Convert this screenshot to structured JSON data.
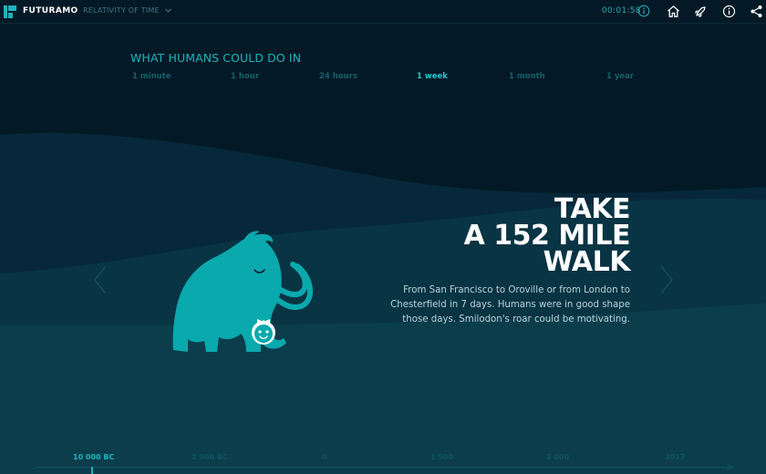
{
  "header": {
    "brand": "FUTURAMO",
    "section": "RELATIVITY OF TIME",
    "timer": "00:01:58",
    "icons": [
      "logo-icon",
      "chevron-down-icon",
      "info-icon",
      "home-icon",
      "rocket-icon",
      "info-icon",
      "share-icon"
    ]
  },
  "periods": {
    "title": "WHAT HUMANS COULD DO IN",
    "items": [
      "1 minute",
      "1 hour",
      "24 hours",
      "1 week",
      "1 month",
      "1 year"
    ],
    "active": "1 week"
  },
  "slide": {
    "headline_lines": [
      "TAKE",
      "A 152 MILE",
      "WALK"
    ],
    "description": "From San Francisco to Oroville or from London to Chesterfield in 7 days. Humans were in good shape those days. Smilodon's roar could be motivating.",
    "illustration": "mammoth-illustration"
  },
  "timeline": {
    "labels": [
      "10 000 BC",
      "2 000 BC",
      "0",
      "1 500",
      "2 000",
      "2017"
    ],
    "active": "10 000 BC"
  },
  "colors": {
    "background": "#031a26",
    "accent": "#1fb3bd",
    "mammoth": "#0aa9ad",
    "hill_back": "#06283a",
    "hill_mid": "#083443",
    "hill_front": "#0b3d4b"
  }
}
